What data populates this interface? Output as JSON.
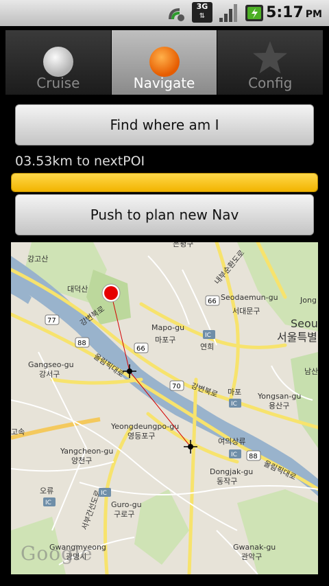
{
  "status_bar": {
    "time": "5:17",
    "ampm": "PM",
    "network": "3G"
  },
  "tabs": [
    {
      "label": "Cruise",
      "icon": "gray-circle-icon",
      "active": false
    },
    {
      "label": "Navigate",
      "icon": "orange-circle-icon",
      "active": true
    },
    {
      "label": "Config",
      "icon": "star-icon",
      "active": false
    }
  ],
  "main": {
    "find_button_label": "Find where am I",
    "distance_text": "03.53km to nextPOI",
    "progress_fraction": 1.0,
    "plan_button_label": "Push to plan new Nav"
  },
  "map": {
    "watermark": "Google",
    "labels": {
      "l1": "강고산",
      "l2": "대덕산",
      "l3": "강변북로",
      "l4": "Mapo-gu",
      "l5": "마포구",
      "l6": "Seodaemun-gu",
      "l7": "서대문구",
      "l8": "Seoul",
      "l9": "서울특별",
      "l10": "Gangseo-gu",
      "l11": "강서구",
      "l12": "올림픽대로",
      "l13": "연희",
      "l14": "강변북로",
      "l15": "마포",
      "l16": "Yongsan-gu",
      "l17": "용산구",
      "l18": "Yeongdeungpo-gu",
      "l19": "영등포구",
      "l20": "여의상류",
      "l21": "Yangcheon-gu",
      "l22": "양천구",
      "l23": "Dongjak-gu",
      "l24": "동작구",
      "l25": "오류",
      "l26": "Guro-gu",
      "l27": "구로구",
      "l28": "Gwangmyeong",
      "l29": "광명시",
      "l30": "Gwanak-gu",
      "l31": "관악구",
      "l32": "Jong",
      "l33": "고속",
      "l34": "은평구",
      "l35": "내부순환도로",
      "l36": "남산",
      "l37": "올림픽대로",
      "l38": "서부간선도로"
    },
    "shields": {
      "s1": "77",
      "s2": "88",
      "s3": "66",
      "s4": "66",
      "s5": "IC",
      "s6": "70",
      "s7": "IC",
      "s8": "IC",
      "s9": "88",
      "s10": "IC",
      "s11": "IC"
    }
  }
}
